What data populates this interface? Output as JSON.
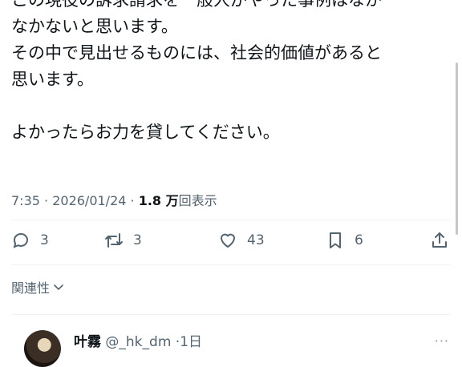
{
  "tweet": {
    "lines": [
      "この現役の訴求請求を一般人がやった事例はなか",
      "なかないと思います。",
      "その中で見出せるものには、社会的価値があると",
      "思います。",
      "",
      "よかったらお力を貸してください。"
    ],
    "time": "7:35",
    "date": "2026/01/24",
    "views_count": "1.8 万",
    "views_label": "回表示"
  },
  "actions": {
    "replies": "3",
    "retweets": "3",
    "likes": "43",
    "bookmarks": "6"
  },
  "sort": {
    "label": "関連性"
  },
  "reply": {
    "name": "叶霧",
    "handle": "@_hk_dm",
    "time": "1日",
    "more": "···"
  },
  "colors": {
    "text": "#0f1419",
    "secondary": "#536471",
    "divider": "#eff3f4"
  }
}
